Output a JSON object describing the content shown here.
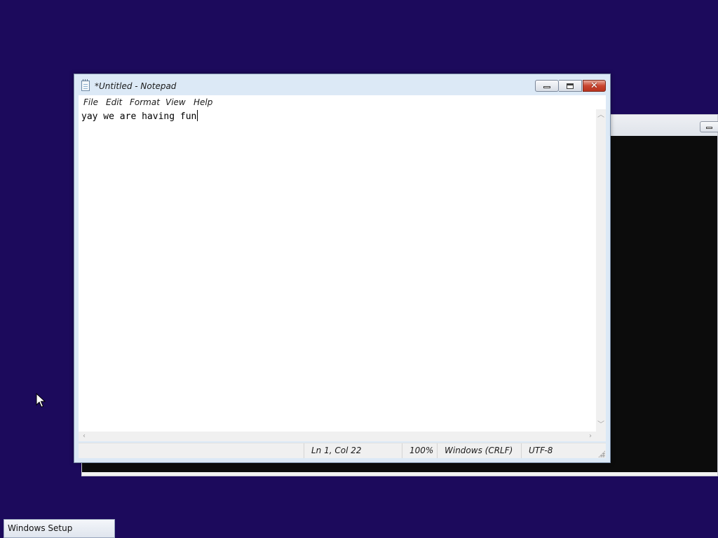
{
  "background_window": {
    "kind": "console"
  },
  "notepad": {
    "title": "*Untitled - Notepad",
    "menu": [
      "File",
      "Edit",
      "Format",
      "View",
      "Help"
    ],
    "content": "yay we are having fun",
    "status": {
      "position": "Ln 1, Col 22",
      "zoom": "100%",
      "line_ending": "Windows (CRLF)",
      "encoding": "UTF-8"
    },
    "buttons": {
      "close_glyph": "✕"
    }
  },
  "taskbar": {
    "item_label": "Windows Setup"
  },
  "colors": {
    "desktop": "#1c0a5c",
    "close_button": "#c9452f",
    "frame": "#dce9f6"
  },
  "icons": {
    "app": "notepad-icon",
    "cursor": "mouse-pointer-icon"
  }
}
